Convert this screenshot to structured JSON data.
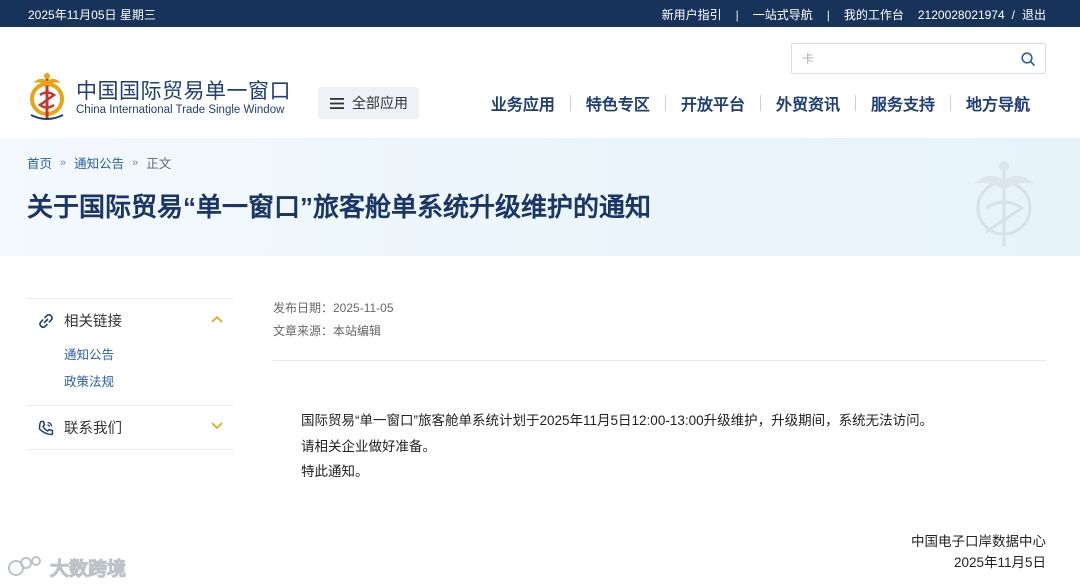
{
  "topbar": {
    "date": "2025年11月05日 星期三",
    "links": [
      "新用户指引",
      "一站式导航",
      "我的工作台",
      "2120028021974",
      "退出"
    ],
    "separator": "|",
    "slash": "/"
  },
  "header": {
    "logo_cn": "中国国际贸易单一窗口",
    "logo_en": "China International Trade Single Window",
    "all_apps": "全部应用",
    "search_placeholder": "卡",
    "nav": [
      "业务应用",
      "特色专区",
      "开放平台",
      "外贸资讯",
      "服务支持",
      "地方导航"
    ]
  },
  "breadcrumb": {
    "home": "首页",
    "section": "通知公告",
    "current": "正文",
    "arrow": "»"
  },
  "article": {
    "title": "关于国际贸易“单一窗口”旅客舱单系统升级维护的通知",
    "publish_date": "发布日期：2025-11-05",
    "source": "文章来源：本站编辑",
    "paragraphs": [
      "国际贸易“单一窗口”旅客舱单系统计划于2025年11月5日12:00-13:00升级维护，升级期间，系统无法访问。",
      "请相关企业做好准备。",
      "特此通知。"
    ],
    "signature_org": "中国电子口岸数据中心",
    "signature_date": "2025年11月5日"
  },
  "sidebar": {
    "sections": [
      {
        "label": "相关链接",
        "icon": "link-icon",
        "expanded": true,
        "items": [
          "通知公告",
          "政策法规"
        ]
      },
      {
        "label": "联系我们",
        "icon": "phone-icon",
        "expanded": false,
        "items": []
      }
    ]
  },
  "overlay": {
    "watermark": "大数跨境"
  },
  "colors": {
    "topbar": "#17335a",
    "brand_navy": "#1f3f74",
    "accent_gold": "#e8a317",
    "link_blue": "#2b5fa8"
  }
}
